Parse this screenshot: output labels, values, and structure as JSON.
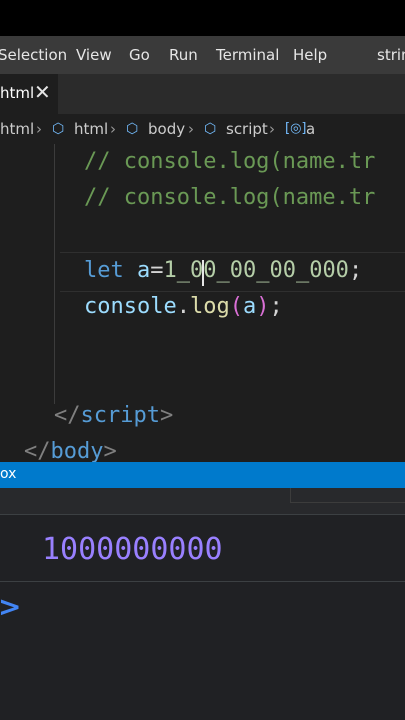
{
  "menu": [
    "Selection",
    "View",
    "Go",
    "Run",
    "Terminal",
    "Help",
    "strin"
  ],
  "tab": {
    "label": "html",
    "close": "✕"
  },
  "breadcrumb": [
    "html",
    "html",
    "body",
    "script",
    "a"
  ],
  "code": {
    "line1_comment": "// console.log(name.tr",
    "line2_comment": "// console.log(name.tr",
    "line3_kw": "let",
    "line3_var": "a",
    "line3_eq": "=",
    "line3_num": "1_00_00_00_000",
    "line3_semi": ";",
    "line4_obj": "console",
    "line4_dot": ".",
    "line4_fn": "log",
    "line4_open": "(",
    "line4_arg": "a",
    "line4_close": ")",
    "line4_semi": ";",
    "close_script_open": "</",
    "close_script_tag": "script",
    "close_script_end": ">",
    "close_body_open": "</",
    "close_body_tag": "body",
    "close_body_end": ">"
  },
  "statusbar": {
    "text": "ox"
  },
  "console": {
    "output": "1000000000",
    "prompt": ">"
  }
}
